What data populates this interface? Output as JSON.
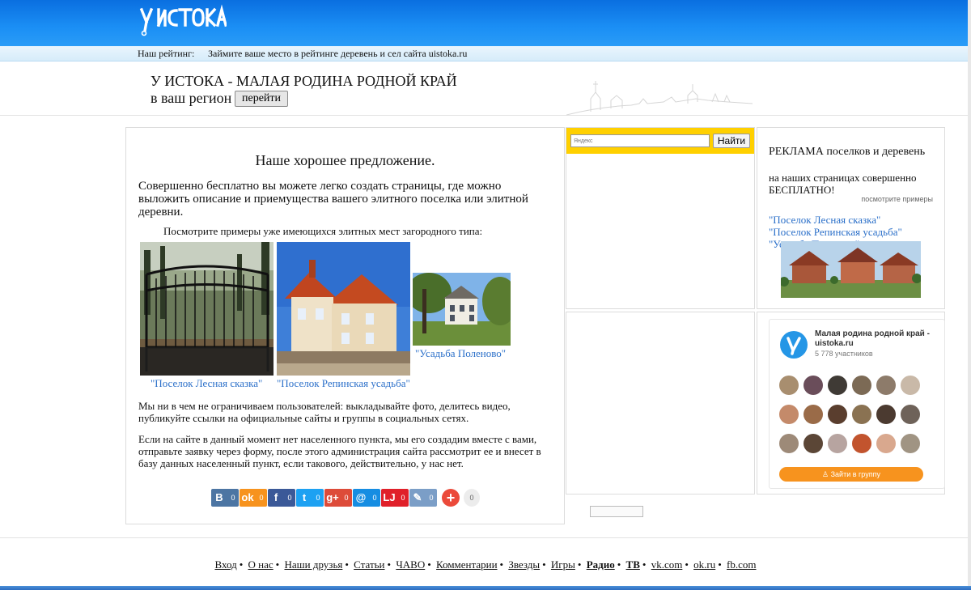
{
  "header": {
    "logo_text": "У ИСТОКА"
  },
  "rating": {
    "label": "Наш рейтинг:",
    "link": "Займите ваше место в рейтинге деревень и сел сайта uistoka.ru"
  },
  "hero": {
    "title": "У ИСТОКА - МАЛАЯ РОДИНА РОДНОЙ КРАЙ",
    "subtitle": "в ваш регион",
    "go_button": "перейти"
  },
  "main": {
    "title": "Наше хорошее предложение.",
    "text": "Совершенно бесплатно вы можете легко создать страницы, где можно выложить описание и приемущества вашего элитного поселка или элитной деревни.",
    "examples_label": "Посмотрите примеры уже имеющихся элитных мест загородного типа:",
    "examples": [
      {
        "caption": "\"Поселок Лесная сказка\""
      },
      {
        "caption": "\"Поселок Репинская усадьба\""
      },
      {
        "caption": "\"Усадьба Поленово\""
      }
    ],
    "para1": "Мы ни в чем не ограничиваем пользователей: выкладывайте фото, делитесь видео, публикуйте ссылки на официальные сайты и группы в социальных сетях.",
    "para2": "Если на сайте в данный момент нет населенного пункта, мы его создадим вместе с вами, отправьте заявку через форму, после этого администрация сайта рассмотрит ее и внесет в базу данных населенный пункт, если такового, действительно, у нас нет.",
    "share": [
      {
        "icon": "В",
        "count": "0",
        "color": "#4c75a3"
      },
      {
        "icon": "ok",
        "count": "0",
        "color": "#f7931e"
      },
      {
        "icon": "f",
        "count": "0",
        "color": "#3b5998"
      },
      {
        "icon": "t",
        "count": "0",
        "color": "#1da1f2"
      },
      {
        "icon": "g+",
        "count": "0",
        "color": "#dd4b39"
      },
      {
        "icon": "@",
        "count": "0",
        "color": "#168de2"
      },
      {
        "icon": "LJ",
        "count": "0",
        "color": "#e0202a"
      },
      {
        "icon": "✎",
        "count": "0",
        "color": "#7b9ec7"
      }
    ],
    "share_total": "0"
  },
  "yandex": {
    "placeholder": "Яндекс",
    "button": "Найти"
  },
  "promo": {
    "title": "РЕКЛАМА поселков и деревень",
    "subtitle": "на наших страницах совершенно БЕСПЛАТНО!",
    "more": "посмотрите примеры",
    "links": [
      "\"Поселок Лесная сказка\"",
      "\"Поселок Репинская усадьба\"",
      "\"Усадьба Поленово\""
    ]
  },
  "ok_group": {
    "name": "Малая родина родной край - uistoka.ru",
    "members": "5 778 участников",
    "join": "Зайти в группу"
  },
  "footer": {
    "links": [
      {
        "label": "Вход",
        "bold": false
      },
      {
        "label": "О нас",
        "bold": false
      },
      {
        "label": "Наши друзья",
        "bold": false
      },
      {
        "label": "Статьи",
        "bold": false
      },
      {
        "label": "ЧАВО",
        "bold": false
      },
      {
        "label": "Комментарии",
        "bold": false
      },
      {
        "label": "Звезды",
        "bold": false
      },
      {
        "label": "Игры",
        "bold": false
      },
      {
        "label": "Радио",
        "bold": true
      },
      {
        "label": "ТВ",
        "bold": true
      },
      {
        "label": "vk.com",
        "bold": false
      },
      {
        "label": "ok.ru",
        "bold": false
      },
      {
        "label": "fb.com",
        "bold": false
      }
    ]
  },
  "colors": {
    "header_blue": "#1b8ff5",
    "link_blue": "#2a6fc9",
    "yandex_yellow": "#ffd000",
    "ok_orange": "#f7931e"
  }
}
